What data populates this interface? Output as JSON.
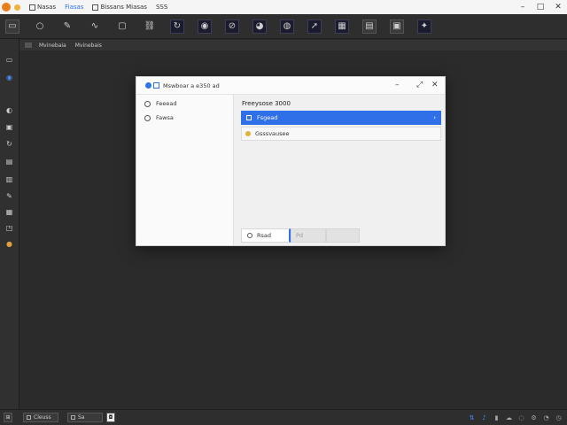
{
  "titlebar": {
    "app_icon_color": "#e8801a",
    "items": [
      "Nasas",
      "Fiasas",
      "Bissans  Miasas",
      "SSS"
    ],
    "controls": [
      "–",
      "□",
      "✕"
    ]
  },
  "toolbar": {
    "tools": [
      "home-icon",
      "circle-icon",
      "pencil-icon",
      "wave-icon",
      "square-icon",
      "link-icon",
      "loop-icon",
      "shield-icon",
      "mask-icon",
      "chat-icon",
      "arrow-icon",
      "layers-icon",
      "note-icon",
      "pages-icon",
      "puzzle-icon"
    ]
  },
  "crumbs": [
    "Mvinebaia",
    "Mvinebais"
  ],
  "dialog": {
    "title": "Mswboar a e350 ad",
    "controls": [
      "–",
      "⤢",
      "✕"
    ],
    "nav": [
      "Feeead",
      "Fawsa"
    ],
    "section_head": "Freeysose 3000",
    "selected_row": "Fsgead",
    "row_item": "Gsssvausee",
    "primary_button": "Rsad",
    "secondary_button": "Pd"
  },
  "statusbar": {
    "buttons": [
      "Cleuss",
      "Sa"
    ],
    "icons": [
      "network-icon",
      "sound-icon",
      "battery-icon",
      "cloud-icon",
      "chat-icon",
      "gear-icon",
      "bell-icon",
      "clock-icon"
    ]
  },
  "accent": "#2f6fe8"
}
